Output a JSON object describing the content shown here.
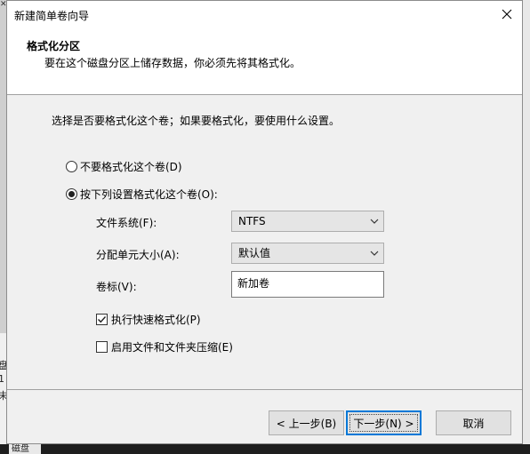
{
  "window": {
    "title": "新建简单卷向导"
  },
  "header": {
    "title": "格式化分区",
    "subtitle": "要在这个磁盘分区上储存数据，你必须先将其格式化。"
  },
  "body": {
    "instruction": "选择是否要格式化这个卷；如果要格式化，要使用什么设置。",
    "option_no_format": "不要格式化这个卷(D)",
    "option_format": "按下列设置格式化这个卷(O):",
    "selected_option": "option_format",
    "filesystem_label": "文件系统(F):",
    "filesystem_value": "NTFS",
    "allocation_label": "分配单元大小(A):",
    "allocation_value": "默认值",
    "volume_label_label": "卷标(V):",
    "volume_label_value": "新加卷",
    "quick_format_label": "执行快速格式化(P)",
    "quick_format_checked": true,
    "compression_label": "启用文件和文件夹压缩(E)",
    "compression_checked": false
  },
  "footer": {
    "back_label": "< 上一步(B)",
    "next_label": "下一步(N) >",
    "cancel_label": "取消"
  },
  "background": {
    "left_fragments": [
      "盘",
      "1",
      "未"
    ],
    "bottom_tab": "磁盘"
  },
  "colors": {
    "accent": "#0078d7",
    "dialog_bg": "#f0f0f0",
    "header_bg": "#ffffff"
  }
}
